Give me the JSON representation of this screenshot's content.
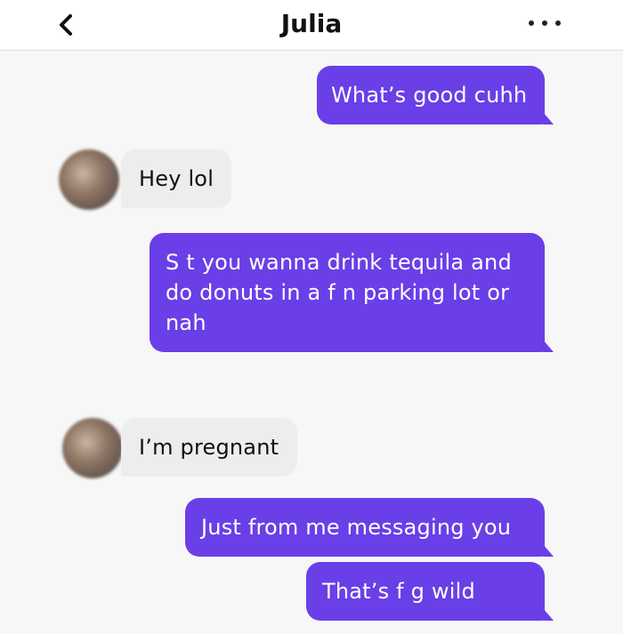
{
  "header": {
    "title": "Julia",
    "back_icon": "chevron-left-icon",
    "more_icon": "more-dots-icon"
  },
  "colors": {
    "outgoing_bubble": "#6a3fe7",
    "incoming_bubble": "#ededed",
    "background": "#f7f7f7"
  },
  "messages": [
    {
      "sender": "me",
      "text": "What’s good cuhh"
    },
    {
      "sender": "them",
      "text": "Hey lol"
    },
    {
      "sender": "me",
      "text": "S  t you wanna drink tequila and do donuts in a f     n parking lot or nah"
    },
    {
      "sender": "them",
      "text": "I’m pregnant"
    },
    {
      "sender": "me",
      "text": "Just from me messaging you"
    },
    {
      "sender": "me",
      "text": "That’s f      g wild"
    }
  ]
}
